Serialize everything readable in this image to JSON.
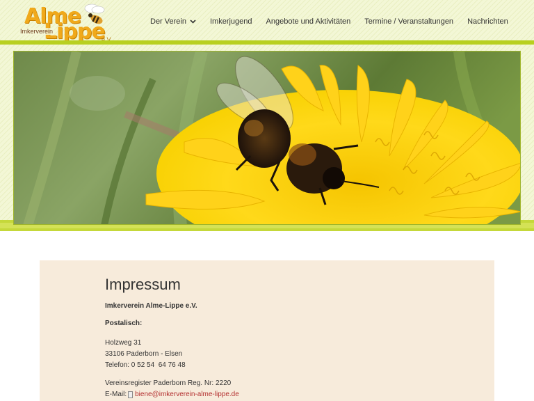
{
  "header": {
    "logo": {
      "word1": "Alme",
      "word2": "Lippe",
      "prefix": "Imkerverein",
      "suffix": "e.V."
    },
    "nav": [
      {
        "label": "Der Verein",
        "has_dropdown": true
      },
      {
        "label": "Imkerjugend"
      },
      {
        "label": "Angebote und Aktivitäten"
      },
      {
        "label": "Termine / Veranstaltungen"
      },
      {
        "label": "Nachrichten"
      }
    ]
  },
  "hero": {
    "icon": "bee-on-dandelion-photo"
  },
  "colors": {
    "accent_green": "#b8d020",
    "content_bg": "#f7ebdb",
    "link": "#b33030",
    "logo_orange": "#f0a91b"
  },
  "content": {
    "title": "Impressum",
    "org_name": "Imkerverein Alme-Lippe e.V.",
    "postal_label": "Postalisch:",
    "address": {
      "street": "Holzweg 31",
      "city": "33106 Paderborn - Elsen",
      "phone": "Telefon: 0 52 54  64 76 48"
    },
    "register": "Vereinsregister Paderborn Reg. Nr: 2220",
    "email_label": "E-Mail:",
    "email_icon": "mail-icon",
    "email": "biene@imkerverein-alme-lippe.de"
  }
}
